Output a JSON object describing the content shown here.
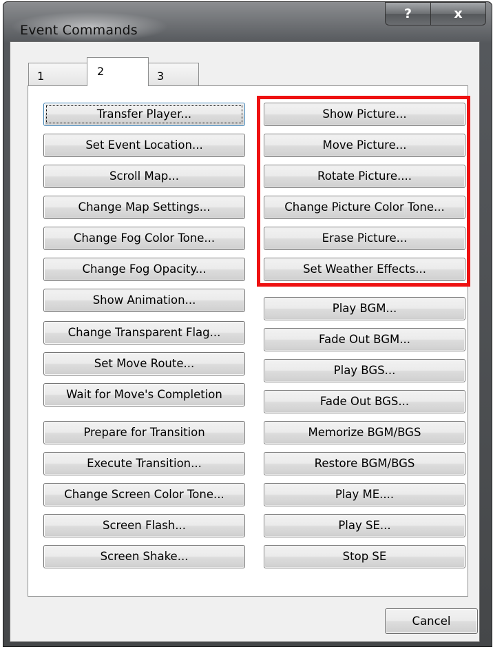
{
  "window": {
    "title": "Event Commands",
    "help_label": "?",
    "close_label": "x"
  },
  "tabs": [
    {
      "label": "1",
      "active": false
    },
    {
      "label": "2",
      "active": true
    },
    {
      "label": "3",
      "active": false
    }
  ],
  "left_column": [
    "Transfer Player...",
    "Set Event Location...",
    "Scroll Map...",
    "Change Map Settings...",
    "Change Fog Color Tone...",
    "Change Fog Opacity...",
    "Show Animation...",
    "Change Transparent Flag...",
    "Set Move Route...",
    "Wait for Move's Completion",
    "Prepare for Transition",
    "Execute Transition...",
    "Change Screen Color Tone...",
    "Screen Flash...",
    "Screen Shake..."
  ],
  "right_column": [
    "Show Picture...",
    "Move Picture...",
    "Rotate Picture....",
    "Change Picture Color Tone...",
    "Erase Picture...",
    "Set Weather Effects...",
    "Play BGM...",
    "Fade Out BGM...",
    "Play BGS...",
    "Fade Out BGS...",
    "Memorize BGM/BGS",
    "Restore BGM/BGS",
    "Play ME....",
    "Play SE...",
    "Stop SE"
  ],
  "footer": {
    "cancel_label": "Cancel"
  },
  "colors": {
    "highlight": "#ee1111"
  }
}
